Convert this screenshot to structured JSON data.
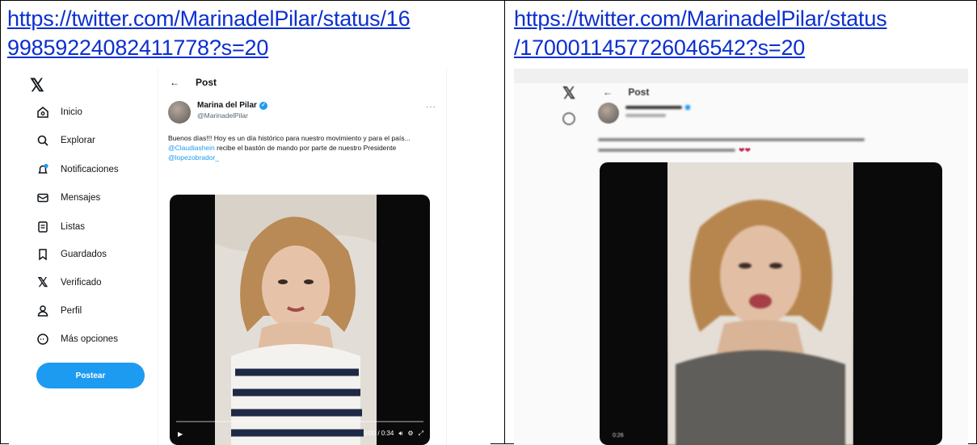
{
  "links": [
    "https://twitter.com/MarinadelPilar/status/1699859224082411778?s=20",
    "https://twitter.com/MarinadelPilar/status/1700011457726046542?s=20"
  ],
  "link_lines": {
    "left": [
      "https://twitter.com/MarinadelPilar/status/16",
      "99859224082411778?s=20"
    ],
    "right": [
      "https://twitter.com/MarinadelPilar/status",
      "/1700011457726046542?s=20"
    ]
  },
  "shot1": {
    "nav": [
      {
        "label": "Inicio",
        "icon": "home-icon"
      },
      {
        "label": "Explorar",
        "icon": "search-icon"
      },
      {
        "label": "Notificaciones",
        "icon": "bell-icon"
      },
      {
        "label": "Mensajes",
        "icon": "mail-icon"
      },
      {
        "label": "Listas",
        "icon": "list-icon"
      },
      {
        "label": "Guardados",
        "icon": "bookmark-icon"
      },
      {
        "label": "Verificado",
        "icon": "x-icon"
      },
      {
        "label": "Perfil",
        "icon": "person-icon"
      },
      {
        "label": "Más opciones",
        "icon": "more-circle-icon"
      }
    ],
    "post_button": "Postear",
    "header_title": "Post",
    "author_name": "Marina del Pilar",
    "author_handle": "@MarinadelPilar",
    "tweet": {
      "text_a": "Buenos días!!! Hoy es un día histórico para nuestro movimiento y para el país... ",
      "mention_1": "@Claudiashein",
      "text_b": " recibe el bastón de mando por parte de nuestro Presidente ",
      "mention_2": "@lopezobrador_"
    },
    "video_time": "0:00 / 0:34",
    "video_progress": 0
  },
  "shot2": {
    "header_title": "Post"
  }
}
